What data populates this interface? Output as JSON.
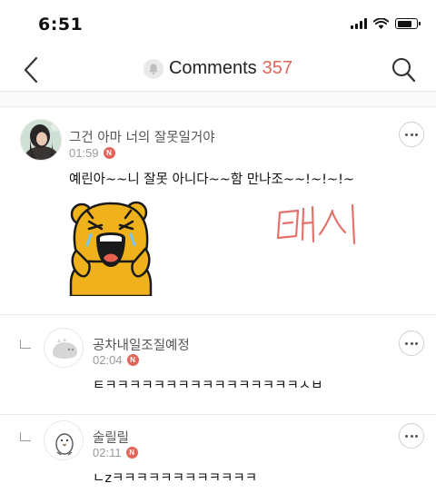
{
  "status_bar": {
    "time": "6:51",
    "icons": [
      "cellular-signal-icon",
      "wifi-icon",
      "battery-icon"
    ]
  },
  "nav": {
    "title": "Comments",
    "count": "357",
    "accent_color": "#e0665a",
    "icons": [
      "back-chevron-icon",
      "bell-icon",
      "search-icon"
    ]
  },
  "comments": [
    {
      "author": "그건 아마 너의 잘못일거야",
      "time": "01:59",
      "badge": "N",
      "text": "예린아~~니 잘못 아니다~~함 만나조~~!~!~!~",
      "attachments": [
        "laughing-bear-sticker",
        "handwritten-red-text"
      ],
      "is_reply": false
    },
    {
      "author": "공차내일조질예정",
      "time": "02:04",
      "badge": "N",
      "text": "ㅌㅋㅋㅋㅋㅋㅋㅋㅋㅋㅋㅋㅋㅋㅋㅋㅋㅅㅂ",
      "is_reply": true
    },
    {
      "author": "술릴릴",
      "time": "02:11",
      "badge": "N",
      "text": "ㄴzㅋㅋㅋㅋㅋㅋㅋㅋㅋㅋㅋㅋ",
      "is_reply": true
    }
  ]
}
